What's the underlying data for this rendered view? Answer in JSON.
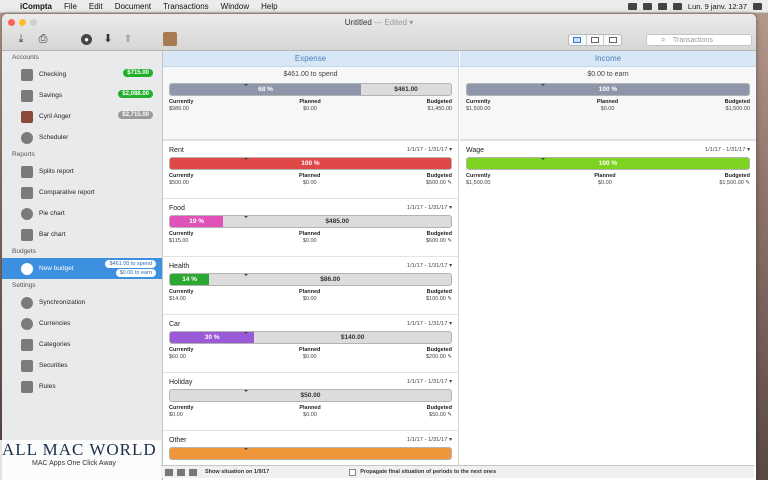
{
  "menubar": {
    "app": "iCompta",
    "items": [
      "File",
      "Edit",
      "Document",
      "Transactions",
      "Window",
      "Help"
    ],
    "clock": "Lun. 9 janv.  12:37"
  },
  "window": {
    "title": "Untitled",
    "edited": "— Edited ▾",
    "search_placeholder": "Transactions"
  },
  "sidebar": {
    "accounts_header": "Accounts",
    "accounts": [
      {
        "label": "Checking",
        "badge": "$715.00"
      },
      {
        "label": "Savings",
        "badge": "$2,088.00"
      },
      {
        "label": "Cyril Anger",
        "badge": "$2,715.00"
      },
      {
        "label": "Scheduler",
        "badge": ""
      }
    ],
    "reports_header": "Reports",
    "reports": [
      "Splits report",
      "Comparative report",
      "Pie chart",
      "Bar chart"
    ],
    "budgets_header": "Budgets",
    "budget": {
      "label": "New budget",
      "badge1": "$461.00 to spend",
      "badge2": "$0.00 to earn"
    },
    "settings_header": "Settings",
    "settings": [
      "Synchronization",
      "Currencies",
      "Categories",
      "Securities",
      "Rules"
    ]
  },
  "expense": {
    "header": "Expense",
    "spend_text": "$461.00 to spend",
    "bar_pct": "68 %",
    "bar_rest": "$461.00",
    "currently": "$989.00",
    "planned": "$0.00",
    "budgeted": "$1,450.00",
    "categories": [
      {
        "name": "Rent",
        "dates": "1/1/17 - 1/31/17 ▾",
        "pct": "100 %",
        "rest": "",
        "currently": "$500.00",
        "planned": "$0.00",
        "budgeted": "$500.00 ✎",
        "color": "#e04848",
        "fill": 1.0
      },
      {
        "name": "Food",
        "dates": "1/1/17 - 1/31/17 ▾",
        "pct": "19 %",
        "rest": "$485.00",
        "currently": "$115.00",
        "planned": "$0.00",
        "budgeted": "$600.00 ✎",
        "color": "#e052b8",
        "fill": 0.19
      },
      {
        "name": "Health",
        "dates": "1/1/17 - 1/31/17 ▾",
        "pct": "14 %",
        "rest": "$86.00",
        "currently": "$14.00",
        "planned": "$0.00",
        "budgeted": "$100.00 ✎",
        "color": "#2aa832",
        "fill": 0.14
      },
      {
        "name": "Car",
        "dates": "1/1/17 - 1/31/17 ▾",
        "pct": "30 %",
        "rest": "$140.00",
        "currently": "$60.00",
        "planned": "$0.00",
        "budgeted": "$200.00 ✎",
        "color": "#9b5bd8",
        "fill": 0.3
      },
      {
        "name": "Holiday",
        "dates": "1/1/17 - 1/31/17 ▾",
        "pct": "",
        "rest": "$50.00",
        "currently": "$0.00",
        "planned": "$0.00",
        "budgeted": "$50.00 ✎",
        "color": "#999999",
        "fill": 0.0
      },
      {
        "name": "Other",
        "dates": "1/1/17 - 1/31/17 ▾",
        "pct": "",
        "rest": "",
        "currently": "",
        "planned": "",
        "budgeted": "",
        "color": "#f0963a",
        "fill": 1.0
      }
    ]
  },
  "income": {
    "header": "Income",
    "earn_text": "$0.00 to earn",
    "bar_pct": "100 %",
    "currently": "$1,500.00",
    "planned": "$0.00",
    "budgeted": "$1,500.00",
    "categories": [
      {
        "name": "Wage",
        "dates": "1/1/17 - 1/31/17 ▾",
        "pct": "100 %",
        "currently": "$1,500.00",
        "planned": "$0.00",
        "budgeted": "$1,500.00 ✎",
        "color": "#7ed321",
        "fill": 1.0
      }
    ]
  },
  "labels": {
    "currently": "Currently",
    "planned": "Planned",
    "budgeted": "Budgeted"
  },
  "footer": {
    "show_situation": "Show situation on  1/9/17",
    "propagate": "Propagate final situation of periods to the next ones"
  },
  "watermark": {
    "title": "ALL MAC WORLD",
    "subtitle": "MAC Apps One Click Away"
  }
}
